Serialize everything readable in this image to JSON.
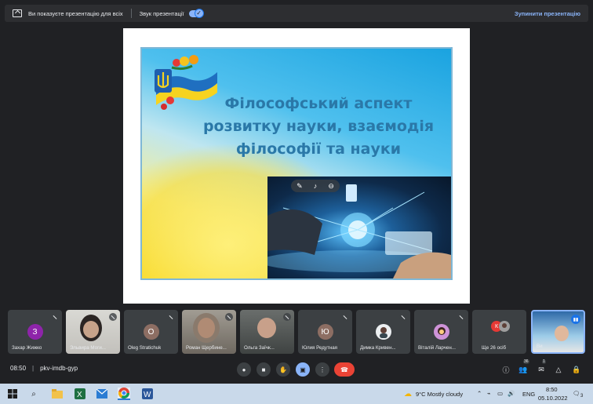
{
  "top_bar": {
    "presenting_message": "Ви показуєте презентацію для всіх",
    "sound_label": "Звук презентації",
    "stop_label": "Зупинити презентацію"
  },
  "slide": {
    "title_line1": "Філософський аспект",
    "title_line2": "розвитку науки, взаємодія",
    "title_line3": "філософії та науки"
  },
  "participants": [
    {
      "name": "Захар Жижко",
      "initial": "З",
      "color": "#8e24aa"
    },
    {
      "name": "Эльвира Моги...",
      "initial": "",
      "color": ""
    },
    {
      "name": "Oleg Stratichuk",
      "initial": "O",
      "color": "#8d6e63"
    },
    {
      "name": "Роман Щербине...",
      "initial": "",
      "color": ""
    },
    {
      "name": "Ольга Заїчк...",
      "initial": "",
      "color": ""
    },
    {
      "name": "Юлия Редутная",
      "initial": "Ю",
      "color": "#8d6e63"
    },
    {
      "name": "Димка Кривен...",
      "initial": "",
      "color": ""
    },
    {
      "name": "Віталій Ларчен...",
      "initial": "",
      "color": ""
    },
    {
      "name": "Ще 26 осіб",
      "initial": "К",
      "color": "#e53935"
    },
    {
      "name": "Ви",
      "initial": "",
      "color": ""
    }
  ],
  "meeting": {
    "time": "08:50",
    "code": "pkv-imdb-gyp",
    "people_count": "36",
    "chat_count": "1"
  },
  "taskbar": {
    "weather": "9°C  Mostly cloudy",
    "lang": "ENG",
    "clock_time": "8:50",
    "clock_date": "05.10.2022",
    "notif_count": "3"
  }
}
